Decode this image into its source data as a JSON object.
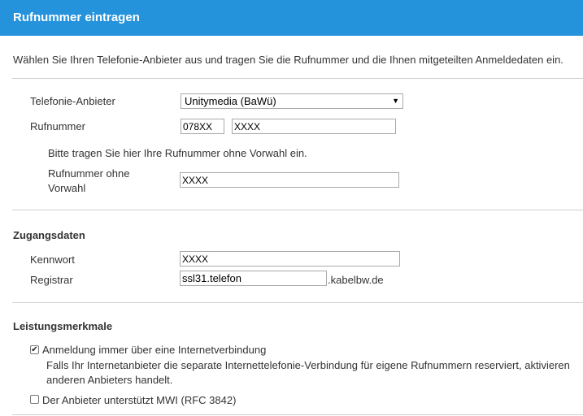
{
  "header": {
    "title": "Rufnummer eintragen"
  },
  "intro": "Wählen Sie Ihren Telefonie-Anbieter aus und tragen Sie die Rufnummer und die Ihnen mitgeteilten Anmeldedaten ein.",
  "provider": {
    "label": "Telefonie-Anbieter",
    "selected": "Unitymedia (BaWü)"
  },
  "number": {
    "label": "Rufnummer",
    "area_code": "078XX",
    "value": "XXXX"
  },
  "hint": "Bitte tragen Sie hier Ihre Rufnummer ohne Vorwahl ein.",
  "number_no_prefix": {
    "label_line1": "Rufnummer ohne",
    "label_line2": "Vorwahl",
    "value": "XXXX"
  },
  "access": {
    "title": "Zugangsdaten",
    "password_label": "Kennwort",
    "password_value": "XXXX",
    "registrar_label": "Registrar",
    "registrar_value": "ssl31.telefon",
    "registrar_suffix": ".kabelbw.de"
  },
  "features": {
    "title": "Leistungsmerkmale",
    "option1": {
      "label": "Anmeldung immer über eine Internetverbindung",
      "checked": true,
      "desc_line1": "Falls Ihr Internetanbieter die separate Internettelefonie-Verbindung für eigene Rufnummern reserviert, aktivieren",
      "desc_line2": "anderen Anbieters handelt."
    },
    "option2": {
      "label": "Der Anbieter unterstützt MWI (RFC 3842)",
      "checked": false
    }
  },
  "icons": {
    "checkbox_checked": "checkmark-icon",
    "dropdown": "dropdown-arrow-icon"
  },
  "colors": {
    "header_bg": "#2592dc",
    "header_text": "#ffffff",
    "divider": "#d0d0d0"
  }
}
